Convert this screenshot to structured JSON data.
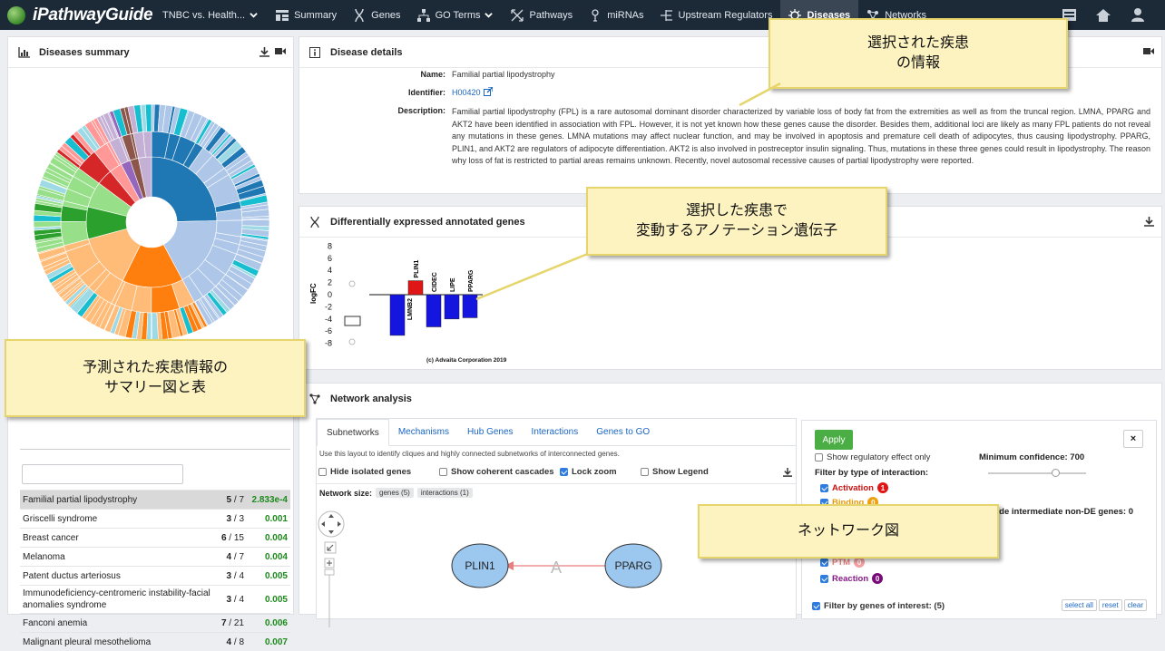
{
  "navbar": {
    "brand": "iPathwayGuide",
    "items": [
      {
        "label": "TNBC vs. Health...",
        "icon": "chevron-down-icon"
      },
      {
        "label": "Summary",
        "icon": "summary-icon"
      },
      {
        "label": "Genes",
        "icon": "dna-icon"
      },
      {
        "label": "GO Terms",
        "icon": "hierarchy-icon"
      },
      {
        "label": "Pathways",
        "icon": "pathways-icon"
      },
      {
        "label": "miRNAs",
        "icon": "mirna-icon"
      },
      {
        "label": "Upstream Regulators",
        "icon": "upstream-icon"
      },
      {
        "label": "Diseases",
        "icon": "virus-icon"
      },
      {
        "label": "Networks",
        "icon": "network-icon"
      }
    ]
  },
  "summary": {
    "title": "Diseases summary",
    "sunburst_colors": [
      "#1f77b4",
      "#aec7e8",
      "#ff7f0e",
      "#ffbb78",
      "#2ca02c",
      "#98df8a",
      "#d62728",
      "#ff9896",
      "#9467bd",
      "#c5b0d5",
      "#8c564b",
      "#e377c2",
      "#17becf",
      "#9edae5",
      "#7f7f7f"
    ],
    "table": [
      {
        "name": "Familial partial lipodystrophy",
        "de": "5",
        "total": "7",
        "p": "2.833e-4",
        "selected": true
      },
      {
        "name": "Griscelli syndrome",
        "de": "3",
        "total": "3",
        "p": "0.001"
      },
      {
        "name": "Breast cancer",
        "de": "6",
        "total": "15",
        "p": "0.004"
      },
      {
        "name": "Melanoma",
        "de": "4",
        "total": "7",
        "p": "0.004"
      },
      {
        "name": "Patent ductus arteriosus",
        "de": "3",
        "total": "4",
        "p": "0.005"
      },
      {
        "name": "Immunodeficiency-centromeric instability-facial anomalies syndrome",
        "de": "3",
        "total": "4",
        "p": "0.005"
      },
      {
        "name": "Fanconi anemia",
        "de": "7",
        "total": "21",
        "p": "0.006"
      },
      {
        "name": "Malignant pleural mesothelioma",
        "de": "4",
        "total": "8",
        "p": "0.007"
      }
    ]
  },
  "details": {
    "title": "Disease details",
    "name_label": "Name:",
    "name": "Familial partial lipodystrophy",
    "id_label": "Identifier:",
    "id": "H00420",
    "desc_label": "Description:",
    "description": "Familial partial lipodystrophy (FPL) is a rare autosomal dominant disorder characterized by variable loss of body fat from the extremities as well as from the truncal region. LMNA, PPARG and AKT2 have been identified in association with FPL. However, it is not yet known how these genes cause the disorder. Besides them, additional loci are likely as many FPL patients do not reveal any mutations in these genes. LMNA mutations may affect nuclear function, and may be involved in apoptosis and premature cell death of adipocytes, thus causing lipodystrophy. PPARG, PLIN1, and AKT2 are regulators of adipocyte differentiation. AKT2 is also involved in postreceptor insulin signaling. Thus, mutations in these three genes could result in lipodystrophy. The reason why loss of fat is restricted to partial areas remains unknown. Recently, novel autosomal recessive causes of partial lipodystrophy were reported."
  },
  "degenes": {
    "title": "Differentially expressed annotated genes",
    "copyright": "(c) Advaita Corporation 2019"
  },
  "chart_data": {
    "type": "bar",
    "ylabel": "logFC",
    "ylim": [
      -8,
      8
    ],
    "yticks": [
      "8",
      "6",
      "4",
      "2",
      "0",
      "-2",
      "-4",
      "-6",
      "-8"
    ],
    "categories": [
      "LMNB2",
      "PLIN1",
      "CIDEC",
      "LIPE",
      "PPARG"
    ],
    "values": [
      -6.7,
      2.3,
      -5.3,
      -4.0,
      -3.8
    ],
    "colors": [
      "#1515e0",
      "#e01515",
      "#1515e0",
      "#1515e0",
      "#1515e0"
    ]
  },
  "network": {
    "title": "Network analysis",
    "tabs": [
      "Subnetworks",
      "Mechanisms",
      "Hub Genes",
      "Interactions",
      "Genes to GO"
    ],
    "hint": "Use this layout to identify cliques and highly connected subnetworks of interconnected genes.",
    "options": [
      "Hide isolated genes",
      "Show coherent cascades",
      "Lock zoom",
      "Show Legend"
    ],
    "network_size_label": "Network size:",
    "genes_pill": "genes (5)",
    "interactions_pill": "interactions (1)",
    "node_a": "PLIN1",
    "node_b": "PPARG",
    "edge_label": "A",
    "apply": "Apply",
    "close": "×",
    "show_reg": "Show regulatory effect only",
    "filter_type": "Filter by type of interaction:",
    "activation": "Activation",
    "activation_count": "1",
    "binding": "Binding",
    "binding_count": "0",
    "ptm": "PTM",
    "ptm_count": "0",
    "reaction": "Reaction",
    "reaction_count": "0",
    "min_conf": "Minimum confidence: 700",
    "include_nonde": "Include intermediate non-DE genes: 0",
    "filter_genes": "Filter by genes of interest: (5)",
    "select_all": "select all",
    "reset": "reset",
    "clear": "clear"
  },
  "callouts": {
    "details": "選択された疾患\nの情報",
    "degenes": "選択した疾患で\n変動するアノテーション遺伝子",
    "summary": "予測された疾患情報の\nサマリー図と表",
    "network": "ネットワーク図"
  }
}
